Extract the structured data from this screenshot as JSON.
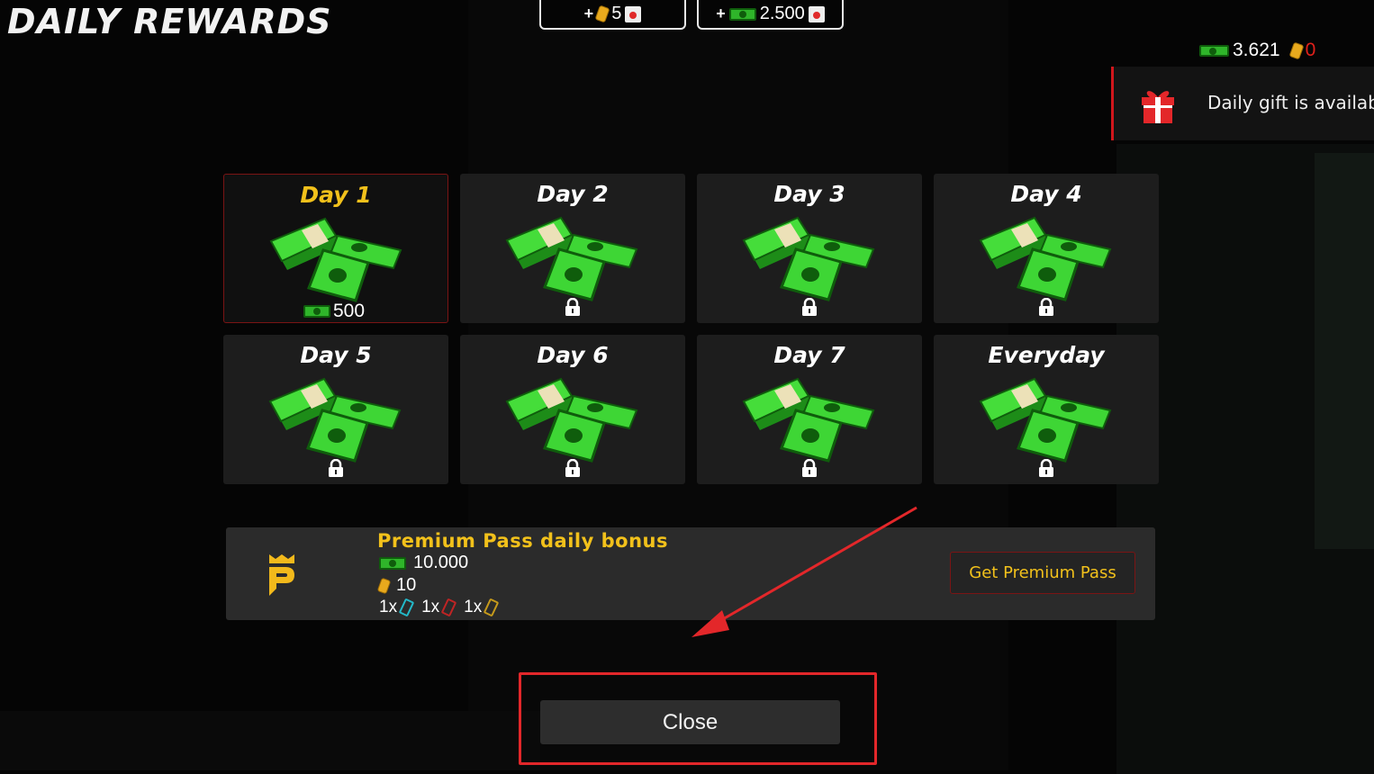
{
  "screen": {
    "title": "DAILY REWARDS"
  },
  "top_buttons": [
    {
      "prefix": "+",
      "amount": "5",
      "icon": "ticket-icon",
      "suffix_icon": "video-icon"
    },
    {
      "prefix": "+",
      "amount": "2.500",
      "icon": "cash-icon",
      "suffix_icon": "video-icon"
    }
  ],
  "currency": {
    "cash": "3.621",
    "tickets": "0"
  },
  "notification": {
    "text": "Daily gift is availab",
    "icon": "gift-icon"
  },
  "days": [
    {
      "label": "Day 1",
      "reward": "500",
      "claimable": true
    },
    {
      "label": "Day 2",
      "locked": true
    },
    {
      "label": "Day 3",
      "locked": true
    },
    {
      "label": "Day 4",
      "locked": true
    },
    {
      "label": "Day 5",
      "locked": true
    },
    {
      "label": "Day 6",
      "locked": true
    },
    {
      "label": "Day 7",
      "locked": true
    },
    {
      "label": "Everyday",
      "locked": true
    }
  ],
  "premium": {
    "title": "Premium Pass daily bonus",
    "cash": "10.000",
    "tickets": "10",
    "items": [
      "1x",
      "1x",
      "1x"
    ],
    "button": "Get Premium Pass"
  },
  "close_button": "Close",
  "colors": {
    "accent_gold": "#f2c11b",
    "alert_red": "#e3272a",
    "cash_green": "#2fb52a"
  }
}
